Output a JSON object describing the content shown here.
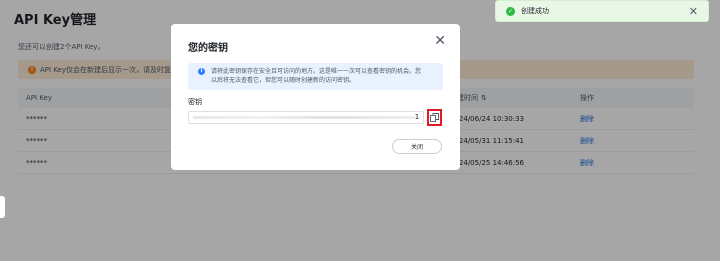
{
  "page": {
    "title": "API Key管理",
    "info": "您还可以创建2个API Key。",
    "warning": "API Key仅会在新建后显示一次，请及时复制并"
  },
  "table": {
    "headers": {
      "key": "API Key",
      "time": "创建时间",
      "op": "操作"
    },
    "rows": [
      {
        "key": "******",
        "time": "2024/06/24 10:30:33",
        "op": "删除"
      },
      {
        "key": "******",
        "time": "2024/05/31 11:15:41",
        "op": "删除"
      },
      {
        "key": "******",
        "time": "2024/05/25 14:46:56",
        "op": "删除"
      }
    ]
  },
  "toast": {
    "text": "创建成功",
    "close": "✕"
  },
  "dialog": {
    "title": "您的密钥",
    "close": "✕",
    "notice_line1": "请将此密钥保存在安全且可访问的地方。这是唯一一次可以查看密钥的机会。您",
    "notice_line2": "以后将无法查看它，但您可以随时创建新的访问密钥。",
    "key_label": "密钥",
    "key_tail": "1",
    "close_button": "关闭"
  },
  "colors": {
    "accent": "#1f6fe5",
    "success": "#2eb843",
    "warning": "#f58220",
    "highlight": "#e01b24"
  }
}
